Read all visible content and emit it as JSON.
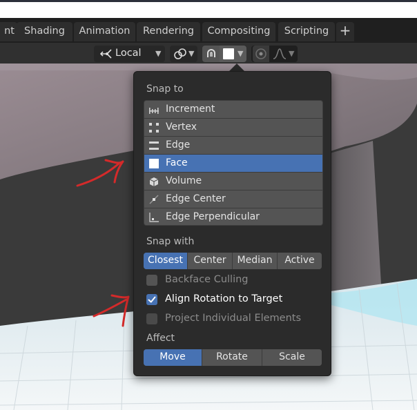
{
  "workspace_tabs": [
    {
      "label": "nt"
    },
    {
      "label": "Shading"
    },
    {
      "label": "Animation"
    },
    {
      "label": "Rendering"
    },
    {
      "label": "Compositing"
    },
    {
      "label": "Scripting"
    }
  ],
  "add_tab_label": "+",
  "header": {
    "orientation_label": "Local"
  },
  "popover": {
    "snap_to_title": "Snap to",
    "snap_to_items": [
      {
        "label": "Increment",
        "icon": "increment-icon"
      },
      {
        "label": "Vertex",
        "icon": "vertex-icon"
      },
      {
        "label": "Edge",
        "icon": "edge-icon"
      },
      {
        "label": "Face",
        "icon": "face-icon",
        "selected": true
      },
      {
        "label": "Volume",
        "icon": "volume-icon"
      },
      {
        "label": "Edge Center",
        "icon": "edge-center-icon"
      },
      {
        "label": "Edge Perpendicular",
        "icon": "edge-perpendicular-icon"
      }
    ],
    "snap_with_title": "Snap with",
    "snap_with_options": [
      {
        "label": "Closest",
        "selected": true
      },
      {
        "label": "Center"
      },
      {
        "label": "Median"
      },
      {
        "label": "Active"
      }
    ],
    "options": [
      {
        "label": "Backface Culling",
        "checked": false
      },
      {
        "label": "Align Rotation to Target",
        "checked": true
      },
      {
        "label": "Project Individual Elements",
        "checked": false
      }
    ],
    "affect_title": "Affect",
    "affect_options": [
      {
        "label": "Move",
        "selected": true
      },
      {
        "label": "Rotate"
      },
      {
        "label": "Scale"
      }
    ]
  },
  "colors": {
    "accent": "#4772b3",
    "annotation": "#d42a2a"
  }
}
